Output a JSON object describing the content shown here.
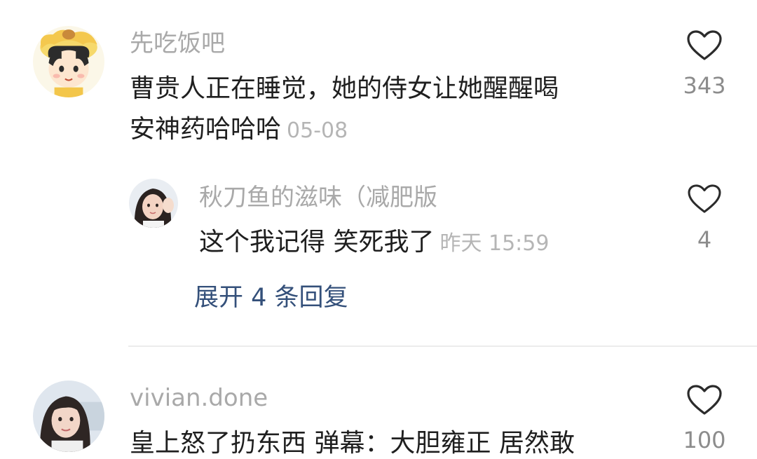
{
  "comments": [
    {
      "username": "先吃饭吧",
      "text_line1": "曹贵人正在睡觉，她的侍女让她醒醒喝",
      "text_line2": "安神药哈哈哈",
      "time": "05-08",
      "likes": "343",
      "avatar_icon": "cartoon-girl-avatar",
      "reply": {
        "username": "秋刀鱼的滋味（减肥版",
        "text": "这个我记得 笑死我了",
        "time": "昨天 15:59",
        "likes": "4",
        "avatar_icon": "girl-photo-avatar"
      },
      "expand_label": "展开 4 条回复"
    },
    {
      "username": "vivian.done",
      "text_line1": "皇上怒了扔东西 弹幕：大胆雍正 居然敢",
      "likes": "100",
      "avatar_icon": "woman-photo-avatar"
    }
  ],
  "colors": {
    "username": "#a9a9a9",
    "text": "#1f1f1f",
    "time": "#b5b5b5",
    "expand_link": "#34507a",
    "heart": "#2b2b2b"
  },
  "icons": {
    "like": "heart-outline-icon"
  }
}
